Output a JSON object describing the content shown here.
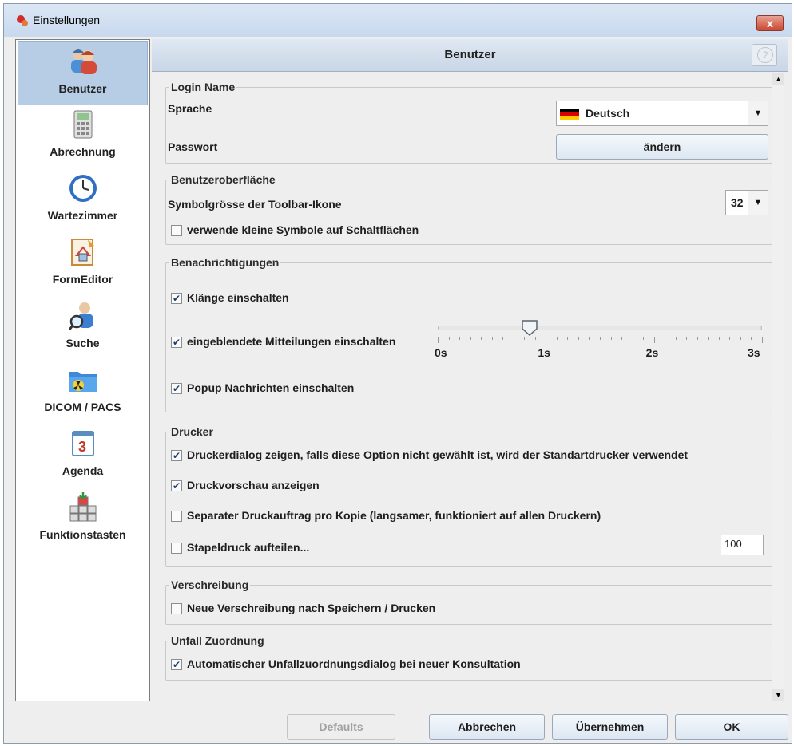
{
  "window": {
    "title": "Einstellungen",
    "close": "x"
  },
  "sidebar": {
    "items": [
      {
        "label": "Benutzer",
        "icon": "users-icon",
        "active": true
      },
      {
        "label": "Abrechnung",
        "icon": "calculator-icon"
      },
      {
        "label": "Wartezimmer",
        "icon": "clock-icon"
      },
      {
        "label": "FormEditor",
        "icon": "form-editor-icon"
      },
      {
        "label": "Suche",
        "icon": "search-user-icon"
      },
      {
        "label": "DICOM / PACS",
        "icon": "dicom-folder-icon"
      },
      {
        "label": "Agenda",
        "icon": "calendar-icon"
      },
      {
        "label": "Funktionstasten",
        "icon": "function-keys-icon"
      }
    ]
  },
  "header": {
    "title": "Benutzer",
    "help": "?"
  },
  "login": {
    "legend": "Login Name",
    "sprache_label": "Sprache",
    "sprache_value": "Deutsch",
    "passwort_label": "Passwort",
    "passwort_button": "ändern"
  },
  "ui": {
    "legend": "Benutzeroberfläche",
    "toolbar_label": "Symbolgrösse der Toolbar-Ikone",
    "toolbar_size": "32",
    "small_icons_label": "verwende kleine Symbole auf Schaltflächen",
    "small_icons_checked": false
  },
  "notifications": {
    "legend": "Benachrichtigungen",
    "sounds_label": "Klänge einschalten",
    "sounds_checked": true,
    "popups_label": "eingeblendete Mitteilungen einschalten",
    "popups_checked": true,
    "slider_ticks": [
      "0s",
      "1s",
      "2s",
      "3s"
    ],
    "slider_value": 0.85,
    "slider_max": 3,
    "popup_messages_label": "Popup Nachrichten einschalten",
    "popup_messages_checked": true
  },
  "printer": {
    "legend": "Drucker",
    "dialog_label": "Druckerdialog zeigen, falls diese Option nicht gewählt ist, wird der Standartdrucker verwendet",
    "dialog_checked": true,
    "preview_label": "Druckvorschau anzeigen",
    "preview_checked": true,
    "separate_label": "Separater Druckauftrag pro Kopie (langsamer, funktioniert auf allen Druckern)",
    "separate_checked": false,
    "batch_label": "Stapeldruck aufteilen...",
    "batch_checked": false,
    "batch_value": "100"
  },
  "prescription": {
    "legend": "Verschreibung",
    "new_label": "Neue Verschreibung nach Speichern / Drucken",
    "new_checked": false
  },
  "accident": {
    "legend": "Unfall Zuordnung",
    "auto_label": "Automatischer Unfallzuordnungsdialog bei neuer Konsultation",
    "auto_checked": true
  },
  "footer": {
    "defaults": "Defaults",
    "cancel": "Abbrechen",
    "apply": "Übernehmen",
    "ok": "OK"
  },
  "colors": {
    "accent": "#b7cde6",
    "check": "#1a3d6e"
  }
}
